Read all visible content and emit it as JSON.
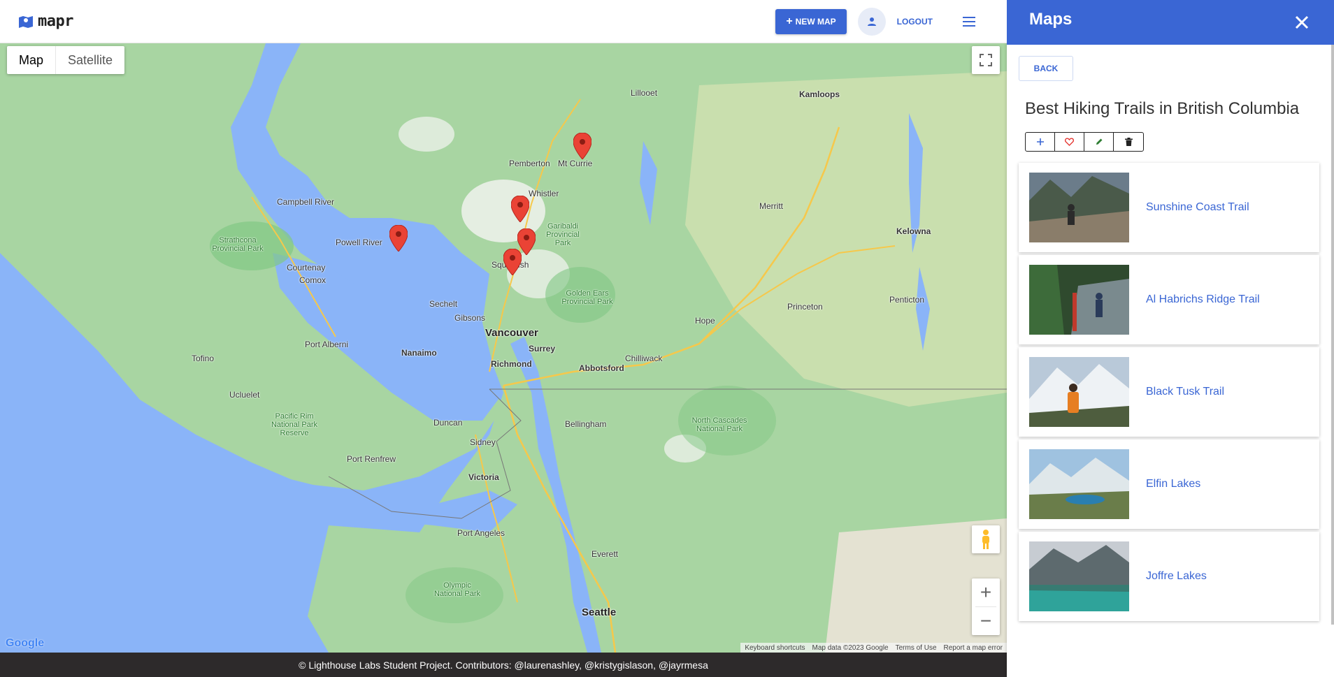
{
  "header": {
    "logo_text": "mapr",
    "new_map_label": "NEW MAP",
    "logout_label": "LOGOUT"
  },
  "map": {
    "type_options": [
      "Map",
      "Satellite"
    ],
    "selected_type": "Map",
    "google_logo": "Google",
    "attribution": {
      "shortcuts": "Keyboard shortcuts",
      "data": "Map data ©2023 Google",
      "terms": "Terms of Use",
      "report": "Report a map error"
    },
    "places": {
      "vancouver": "Vancouver",
      "surrey": "Surrey",
      "richmond": "Richmond",
      "abbotsford": "Abbotsford",
      "nanaimo": "Nanaimo",
      "victoria": "Victoria",
      "seattle": "Seattle",
      "kamloops": "Kamloops",
      "kelowna": "Kelowna",
      "whistler": "Whistler",
      "squamish": "Squamish",
      "pemberton": "Pemberton",
      "mt_currie": "Mt Currie",
      "campbell_river": "Campbell River",
      "courtenay": "Courtenay",
      "comox": "Comox",
      "powell_river": "Powell River",
      "port_alberni": "Port Alberni",
      "tofino": "Tofino",
      "ucluelet": "Ucluelet",
      "duncan": "Duncan",
      "sidney": "Sidney",
      "bellingham": "Bellingham",
      "chilliwack": "Chilliwack",
      "hope": "Hope",
      "merritt": "Merritt",
      "penticton": "Penticton",
      "princeton": "Princeton",
      "lillooet": "Lillooet",
      "port_angeles": "Port Angeles",
      "everett": "Everett",
      "sechelt": "Sechelt",
      "gibsons": "Gibsons",
      "port_renfrew": "Port Renfrew",
      "pacific_rim": "Pacific Rim National Park Reserve",
      "garibaldi": "Garibaldi Provincial Park",
      "golden_ears": "Golden Ears Provincial Park",
      "strathcona": "Strathcona Provincial Park",
      "north_cascades": "North Cascades National Park",
      "olympic": "Olympic National Park"
    }
  },
  "footer": {
    "text": "© Lighthouse Labs Student Project. Contributors: @laurenashley, @kristygislason, @jayrmesa"
  },
  "panel": {
    "title": "Maps",
    "back_label": "BACK",
    "map_title": "Best Hiking Trails in British Columbia",
    "trails": [
      {
        "name": "Sunshine Coast Trail"
      },
      {
        "name": "Al Habrichs Ridge Trail"
      },
      {
        "name": "Black Tusk Trail"
      },
      {
        "name": "Elfin Lakes"
      },
      {
        "name": "Joffre Lakes"
      }
    ]
  },
  "colors": {
    "accent": "#3a66d4",
    "water": "#8ab4f8",
    "land": "#a8d5a2",
    "pin": "#ea4335",
    "footer_bg": "#2d2a2b"
  }
}
